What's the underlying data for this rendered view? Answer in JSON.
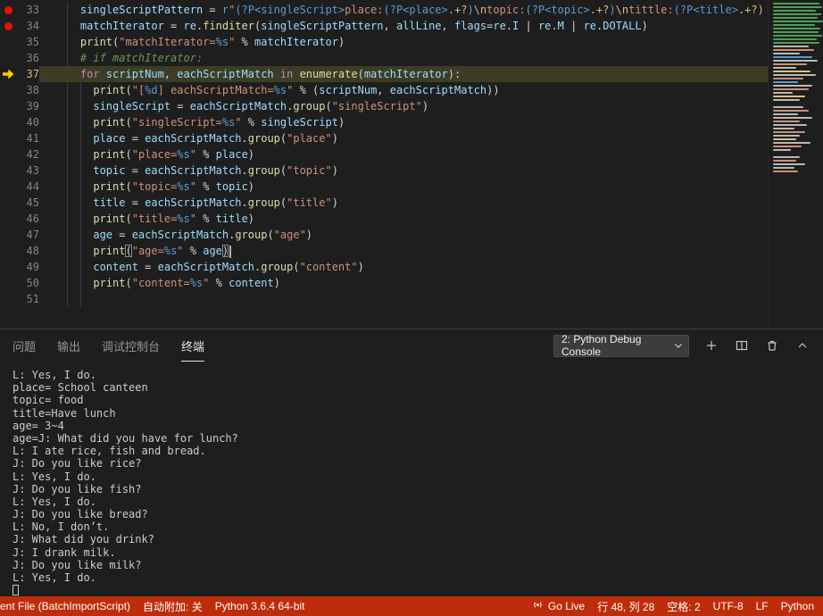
{
  "editor": {
    "lines": [
      {
        "num": 33,
        "bp": true,
        "guides": [
          2
        ],
        "tokens": [
          [
            "v",
            "    singleScriptPattern "
          ],
          [
            "o",
            "= "
          ],
          [
            "kb",
            "r"
          ],
          [
            "s",
            "\""
          ],
          [
            "rx",
            "(?P<singleScript>"
          ],
          [
            "s",
            "place:"
          ],
          [
            "rx",
            "(?P<place>"
          ],
          [
            "e",
            ".+?"
          ],
          [
            "rx",
            ")"
          ],
          [
            "e",
            "\\n"
          ],
          [
            "s",
            "topic:"
          ],
          [
            "rx",
            "(?P<topic>"
          ],
          [
            "e",
            ".+?"
          ],
          [
            "rx",
            ")"
          ],
          [
            "e",
            "\\n"
          ],
          [
            "s",
            "tittle:"
          ],
          [
            "rx",
            "(?P<title>"
          ],
          [
            "e",
            ".+?)"
          ]
        ]
      },
      {
        "num": 34,
        "bp": true,
        "guides": [
          2
        ],
        "tokens": [
          [
            "v",
            "    matchIterator "
          ],
          [
            "o",
            "= "
          ],
          [
            "v",
            "re"
          ],
          [
            "o",
            "."
          ],
          [
            "f",
            "finditer"
          ],
          [
            "o",
            "("
          ],
          [
            "v",
            "singleScriptPattern"
          ],
          [
            "o",
            ", "
          ],
          [
            "v",
            "allLine"
          ],
          [
            "o",
            ", "
          ],
          [
            "v",
            "flags"
          ],
          [
            "o",
            "="
          ],
          [
            "v",
            "re"
          ],
          [
            "o",
            "."
          ],
          [
            "v",
            "I"
          ],
          [
            "o",
            " | "
          ],
          [
            "v",
            "re"
          ],
          [
            "o",
            "."
          ],
          [
            "v",
            "M"
          ],
          [
            "o",
            " | "
          ],
          [
            "v",
            "re"
          ],
          [
            "o",
            "."
          ],
          [
            "v",
            "DOTALL"
          ],
          [
            "o",
            ")"
          ]
        ]
      },
      {
        "num": 35,
        "guides": [
          2
        ],
        "tokens": [
          [
            "f",
            "    print"
          ],
          [
            "o",
            "("
          ],
          [
            "s",
            "\"matchIterator="
          ],
          [
            "fs",
            "%s"
          ],
          [
            "s",
            "\""
          ],
          [
            "o",
            " % "
          ],
          [
            "v",
            "matchIterator"
          ],
          [
            "o",
            ")"
          ]
        ]
      },
      {
        "num": 36,
        "guides": [
          2
        ],
        "tokens": [
          [
            "c",
            "    # if matchIterator:"
          ]
        ]
      },
      {
        "num": 37,
        "current": true,
        "guides": [
          2
        ],
        "tokens": [
          [
            "k",
            "    for "
          ],
          [
            "v",
            "scriptNum"
          ],
          [
            "o",
            ", "
          ],
          [
            "v",
            "eachScriptMatch"
          ],
          [
            "k",
            " in "
          ],
          [
            "f",
            "enumerate"
          ],
          [
            "o",
            "("
          ],
          [
            "v",
            "matchIterator"
          ],
          [
            "o",
            "):"
          ]
        ]
      },
      {
        "num": 38,
        "guides": [
          2,
          4
        ],
        "tokens": [
          [
            "f",
            "      print"
          ],
          [
            "o",
            "("
          ],
          [
            "s",
            "\"["
          ],
          [
            "fs",
            "%d"
          ],
          [
            "s",
            "] eachScriptMatch="
          ],
          [
            "fs",
            "%s"
          ],
          [
            "s",
            "\""
          ],
          [
            "o",
            " % ("
          ],
          [
            "v",
            "scriptNum"
          ],
          [
            "o",
            ", "
          ],
          [
            "v",
            "eachScriptMatch"
          ],
          [
            "o",
            "))"
          ]
        ]
      },
      {
        "num": 39,
        "guides": [
          2,
          4
        ],
        "tokens": [
          [
            "v",
            "      singleScript "
          ],
          [
            "o",
            "= "
          ],
          [
            "v",
            "eachScriptMatch"
          ],
          [
            "o",
            "."
          ],
          [
            "f",
            "group"
          ],
          [
            "o",
            "("
          ],
          [
            "s",
            "\"singleScript\""
          ],
          [
            "o",
            ")"
          ]
        ]
      },
      {
        "num": 40,
        "guides": [
          2,
          4
        ],
        "tokens": [
          [
            "f",
            "      print"
          ],
          [
            "o",
            "("
          ],
          [
            "s",
            "\"singleScript="
          ],
          [
            "fs",
            "%s"
          ],
          [
            "s",
            "\""
          ],
          [
            "o",
            " % "
          ],
          [
            "v",
            "singleScript"
          ],
          [
            "o",
            ")"
          ]
        ]
      },
      {
        "num": 41,
        "guides": [
          2,
          4
        ],
        "tokens": [
          [
            "v",
            "      place "
          ],
          [
            "o",
            "= "
          ],
          [
            "v",
            "eachScriptMatch"
          ],
          [
            "o",
            "."
          ],
          [
            "f",
            "group"
          ],
          [
            "o",
            "("
          ],
          [
            "s",
            "\"place\""
          ],
          [
            "o",
            ")"
          ]
        ]
      },
      {
        "num": 42,
        "guides": [
          2,
          4
        ],
        "tokens": [
          [
            "f",
            "      print"
          ],
          [
            "o",
            "("
          ],
          [
            "s",
            "\"place="
          ],
          [
            "fs",
            "%s"
          ],
          [
            "s",
            "\""
          ],
          [
            "o",
            " % "
          ],
          [
            "v",
            "place"
          ],
          [
            "o",
            ")"
          ]
        ]
      },
      {
        "num": 43,
        "guides": [
          2,
          4
        ],
        "tokens": [
          [
            "v",
            "      topic "
          ],
          [
            "o",
            "= "
          ],
          [
            "v",
            "eachScriptMatch"
          ],
          [
            "o",
            "."
          ],
          [
            "f",
            "group"
          ],
          [
            "o",
            "("
          ],
          [
            "s",
            "\"topic\""
          ],
          [
            "o",
            ")"
          ]
        ]
      },
      {
        "num": 44,
        "guides": [
          2,
          4
        ],
        "tokens": [
          [
            "f",
            "      print"
          ],
          [
            "o",
            "("
          ],
          [
            "s",
            "\"topic="
          ],
          [
            "fs",
            "%s"
          ],
          [
            "s",
            "\""
          ],
          [
            "o",
            " % "
          ],
          [
            "v",
            "topic"
          ],
          [
            "o",
            ")"
          ]
        ]
      },
      {
        "num": 45,
        "guides": [
          2,
          4
        ],
        "tokens": [
          [
            "v",
            "      title "
          ],
          [
            "o",
            "= "
          ],
          [
            "v",
            "eachScriptMatch"
          ],
          [
            "o",
            "."
          ],
          [
            "f",
            "group"
          ],
          [
            "o",
            "("
          ],
          [
            "s",
            "\"title\""
          ],
          [
            "o",
            ")"
          ]
        ]
      },
      {
        "num": 46,
        "guides": [
          2,
          4
        ],
        "tokens": [
          [
            "f",
            "      print"
          ],
          [
            "o",
            "("
          ],
          [
            "s",
            "\"title="
          ],
          [
            "fs",
            "%s"
          ],
          [
            "s",
            "\""
          ],
          [
            "o",
            " % "
          ],
          [
            "v",
            "title"
          ],
          [
            "o",
            ")"
          ]
        ]
      },
      {
        "num": 47,
        "guides": [
          2,
          4
        ],
        "tokens": [
          [
            "v",
            "      age "
          ],
          [
            "o",
            "= "
          ],
          [
            "v",
            "eachScriptMatch"
          ],
          [
            "o",
            "."
          ],
          [
            "f",
            "group"
          ],
          [
            "o",
            "("
          ],
          [
            "s",
            "\"age\""
          ],
          [
            "o",
            ")"
          ]
        ]
      },
      {
        "num": 48,
        "cursor": true,
        "guides": [
          2,
          4
        ],
        "tokens": [
          [
            "f",
            "      print"
          ],
          [
            "o",
            "(",
            "bx"
          ],
          [
            "s",
            "\"age="
          ],
          [
            "fs",
            "%s"
          ],
          [
            "s",
            "\""
          ],
          [
            "o",
            " % "
          ],
          [
            "v",
            "age"
          ],
          [
            "o",
            ")",
            "bx"
          ]
        ]
      },
      {
        "num": 49,
        "guides": [
          2,
          4
        ],
        "tokens": [
          [
            "v",
            "      content "
          ],
          [
            "o",
            "= "
          ],
          [
            "v",
            "eachScriptMatch"
          ],
          [
            "o",
            "."
          ],
          [
            "f",
            "group"
          ],
          [
            "o",
            "("
          ],
          [
            "s",
            "\"content\""
          ],
          [
            "o",
            ")"
          ]
        ]
      },
      {
        "num": 50,
        "guides": [
          2,
          4
        ],
        "tokens": [
          [
            "f",
            "      print"
          ],
          [
            "o",
            "("
          ],
          [
            "s",
            "\"content="
          ],
          [
            "fs",
            "%s"
          ],
          [
            "s",
            "\""
          ],
          [
            "o",
            " % "
          ],
          [
            "v",
            "content"
          ],
          [
            "o",
            ")"
          ]
        ]
      },
      {
        "num": 51,
        "guides": [
          2,
          4
        ],
        "tokens": []
      }
    ],
    "minimap_rows": [
      [
        "g",
        52
      ],
      [
        "g",
        55
      ],
      [
        "g",
        48
      ],
      [
        "g",
        54
      ],
      [
        "g",
        50
      ],
      [
        "g",
        56
      ],
      [
        "g",
        47
      ],
      [
        "g",
        53
      ],
      [
        "g",
        51
      ],
      [
        "g",
        55
      ],
      [
        "g",
        49
      ],
      [
        "g",
        52
      ],
      [
        "w",
        40
      ],
      [
        "o",
        46
      ],
      [
        "w",
        30
      ],
      [
        "b",
        44
      ],
      [
        "w",
        50
      ],
      [
        "o",
        38
      ],
      [
        "w",
        26
      ],
      [
        "y",
        42
      ],
      [
        "w",
        48
      ],
      [
        "o",
        34
      ],
      [
        "b",
        28
      ],
      [
        "w",
        44
      ],
      [
        "o",
        40
      ],
      [
        "w",
        22
      ],
      [
        "y",
        36
      ],
      [
        "w",
        30
      ],
      [
        "x",
        0
      ],
      [
        "w",
        34
      ],
      [
        "o",
        40
      ],
      [
        "w",
        28
      ],
      [
        "w",
        44
      ],
      [
        "o",
        30
      ],
      [
        "w",
        38
      ],
      [
        "w",
        24
      ],
      [
        "o",
        36
      ],
      [
        "w",
        30
      ],
      [
        "y",
        26
      ],
      [
        "w",
        42
      ],
      [
        "o",
        32
      ],
      [
        "w",
        20
      ],
      [
        "x",
        0
      ],
      [
        "w",
        30
      ],
      [
        "o",
        26
      ],
      [
        "w",
        36
      ],
      [
        "w",
        24
      ],
      [
        "o",
        28
      ]
    ]
  },
  "panel": {
    "tabs": [
      {
        "label": "问题"
      },
      {
        "label": "输出"
      },
      {
        "label": "调试控制台"
      },
      {
        "label": "终端",
        "active": true
      }
    ],
    "terminal_selector": "2: Python Debug Console",
    "action_icons": [
      "new-terminal",
      "split-terminal",
      "kill-terminal",
      "collapse-panel"
    ]
  },
  "terminal": {
    "lines": [
      "L: Yes, I do.",
      "place= School canteen",
      "topic= food",
      "title=Have lunch",
      "age= 3~4",
      "age=J: What did you have for lunch?",
      "L: I ate rice, fish and bread.",
      "J: Do you like rice?",
      "L: Yes, I do.",
      "J: Do you like fish?",
      "L: Yes, I do.",
      "J: Do you like bread?",
      "L: No, I don’t.",
      "J: What did you drink?",
      "J: I drank milk.",
      "J: Do you like milk?",
      "L: Yes, I do."
    ],
    "cursor_visible": true
  },
  "statusbar": {
    "file_info": "ent File (BatchImportScript)",
    "auto_attach": "自动附加: 关",
    "python_version": "Python 3.6.4 64-bit",
    "go_live": "Go Live",
    "cursor_position": "行 48, 列 28",
    "indentation": "空格: 2",
    "encoding": "UTF-8",
    "eol": "LF",
    "language": "Python"
  },
  "colors": {
    "statusbar_background": "#be2d0a",
    "breakpoint": "#e51400",
    "debug_arrow": "#ffcc00",
    "editor_background": "#1e1e1e",
    "terminal_text": "#cccccc"
  }
}
